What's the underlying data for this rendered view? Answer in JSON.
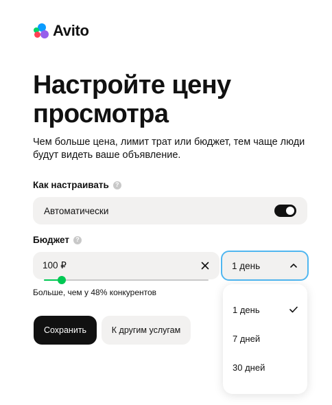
{
  "brand": {
    "name": "Avito"
  },
  "page": {
    "title": "Настройте цену просмотра",
    "subtitle": "Чем больше цена, лимит трат или бюджет, тем чаще люди будут видеть ваше объявление."
  },
  "how": {
    "label": "Как настраивать",
    "help": "?",
    "mode_value": "Автоматически",
    "toggle_on": true
  },
  "budget": {
    "label": "Бюджет",
    "help": "?",
    "value": "100 ₽",
    "slider_fraction": 0.11,
    "hint": "Больше, чем у 48% конкурентов"
  },
  "period": {
    "selected": "1 день",
    "options": [
      {
        "label": "1 день",
        "checked": true
      },
      {
        "label": "7 дней",
        "checked": false
      },
      {
        "label": "30 дней",
        "checked": false
      }
    ]
  },
  "actions": {
    "save_label": "Сохранить",
    "other_label": "К другим услугам"
  },
  "colors": {
    "accent_green": "#00c853",
    "focus_blue": "#4fb6f0",
    "primary_button": "#111111"
  }
}
